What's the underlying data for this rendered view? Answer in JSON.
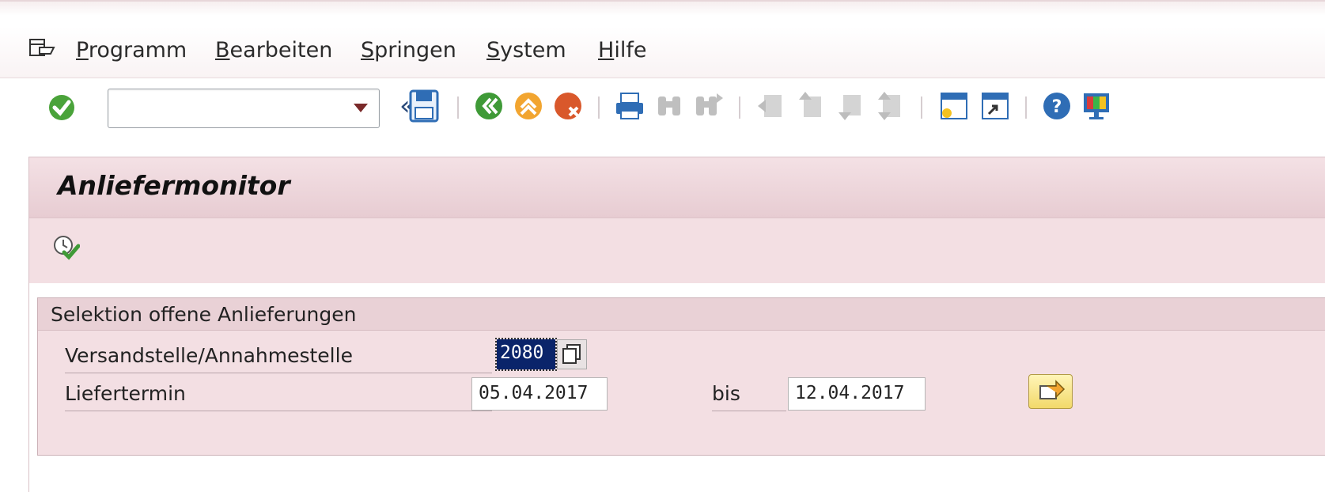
{
  "menu": {
    "items": [
      "Programm",
      "Bearbeiten",
      "Springen",
      "System",
      "Hilfe"
    ]
  },
  "toolbar": {
    "command_field_value": "",
    "icons": [
      "enter-check-icon",
      "command-field-dropdown",
      "collapse-chevron-icon",
      "save-icon",
      "back-icon",
      "exit-icon",
      "cancel-icon",
      "print-icon",
      "find-icon",
      "find-next-icon",
      "first-page-icon",
      "previous-page-icon",
      "next-page-icon",
      "last-page-icon",
      "new-session-icon",
      "shortcut-icon",
      "help-icon",
      "customize-layout-icon"
    ]
  },
  "title": "Anliefermonitor",
  "app_toolbar": {
    "icons": [
      "execute-icon"
    ]
  },
  "selection": {
    "group_title": "Selektion offene Anlieferungen",
    "fields": [
      {
        "label": "Versandstelle/Annahmestelle",
        "value": "2080"
      },
      {
        "label": "Liefertermin",
        "value_from": "05.04.2017",
        "to_label": "bis",
        "value_to": "12.04.2017"
      }
    ]
  },
  "colors": {
    "background": "#f3dfe3",
    "title_bar": "#e7ccd2",
    "selected_text_bg": "#0a246a",
    "button_yellow": "#f2d96a"
  }
}
